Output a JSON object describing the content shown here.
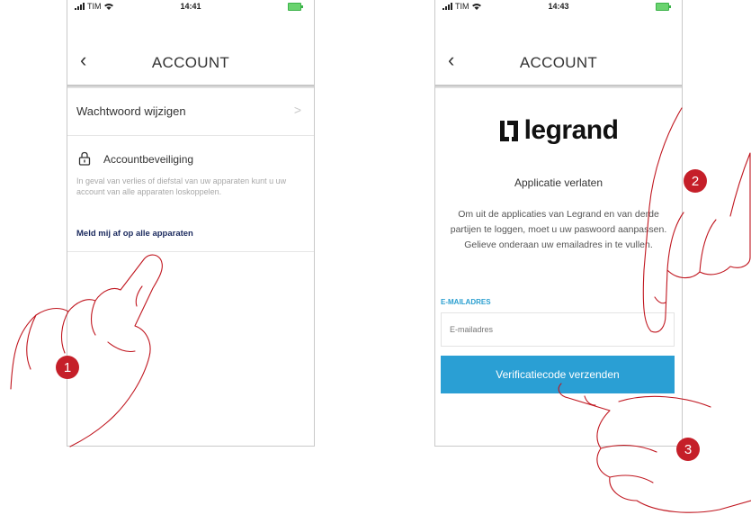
{
  "screen1": {
    "status": {
      "carrier": "TIM",
      "time": "14:41"
    },
    "nav": {
      "title": "ACCOUNT"
    },
    "change_password": "Wachtwoord wijzigen",
    "security": {
      "heading": "Accountbeveiliging",
      "description": "In geval van verlies of diefstal van uw apparaten kunt u uw account van alle apparaten loskoppelen.",
      "logout_link": "Meld mij af op alle apparaten"
    }
  },
  "screen2": {
    "status": {
      "carrier": "TIM",
      "time": "14:43"
    },
    "nav": {
      "title": "ACCOUNT"
    },
    "logo_text": "legrand",
    "exit_title": "Applicatie verlaten",
    "exit_description": "Om uit de applicaties van Legrand en van derde partijen te loggen, moet u uw paswoord aanpassen. Gelieve onderaan uw emailadres in te vullen.",
    "email_label": "E-MAILADRES",
    "email_placeholder": "E-mailadres",
    "send_button": "Verificatiecode verzenden"
  },
  "steps": [
    "1",
    "2",
    "3"
  ],
  "colors": {
    "accent": "#2a9fd4",
    "badge": "#c51f29",
    "link": "#1b2a5e",
    "hand_outline": "#c0161f"
  }
}
